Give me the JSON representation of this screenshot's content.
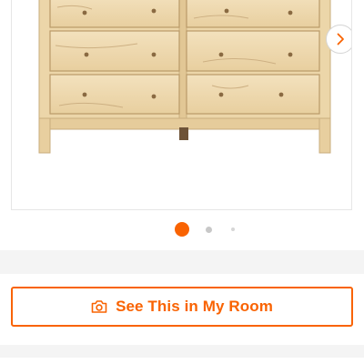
{
  "gallery": {
    "image_subject": "natural-pine-8-drawer-dresser",
    "next_icon": "chevron-right-icon",
    "dot_count": 3,
    "active_index": 0
  },
  "actions": {
    "see_in_room_label": "See This in My Room",
    "see_in_room_icon": "camera-icon"
  },
  "colors": {
    "accent": "#f96302",
    "dot_inactive": "#c8c8c8",
    "dot_faint": "#d6d6d6",
    "band": "#f4f4f4"
  }
}
